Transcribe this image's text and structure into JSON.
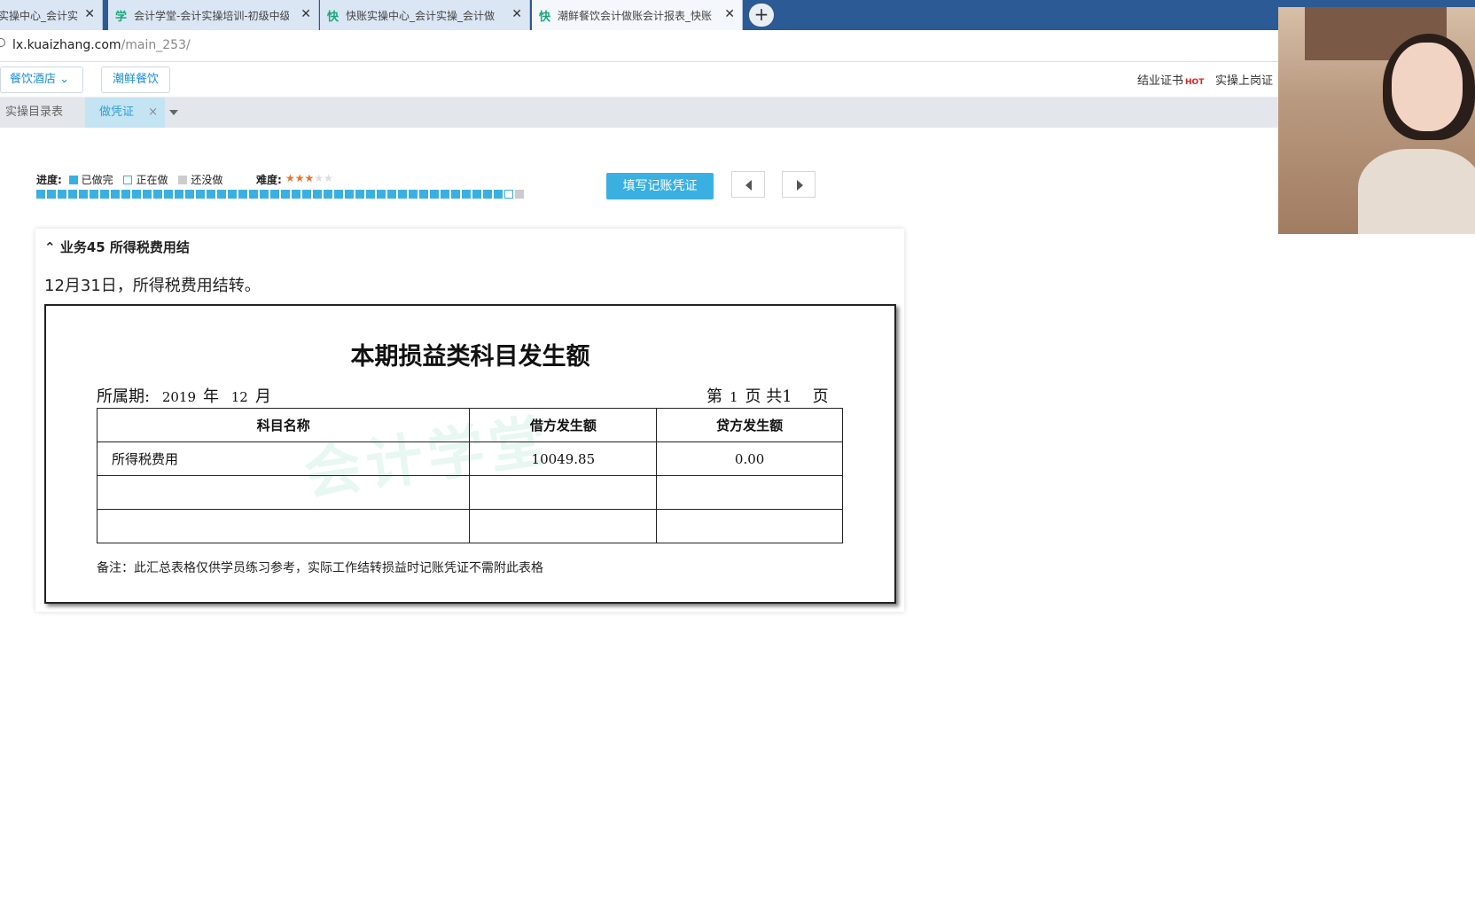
{
  "browser_tabs": [
    {
      "icon": "",
      "title": "实操中心_会计实",
      "active": false
    },
    {
      "icon": "学",
      "title": "会计学堂-会计实操培训-初级中级",
      "active": false
    },
    {
      "icon": "快",
      "title": "快账实操中心_会计实操_会计做",
      "active": false
    },
    {
      "icon": "快",
      "title": "潮鲜餐饮会计做账会计报表_快账",
      "active": true
    }
  ],
  "address": {
    "host": "lx.kuaizhang.com",
    "path": "/main_253/"
  },
  "nav": {
    "industry_label": "餐饮酒店",
    "company_label": "潮鲜餐饮",
    "cert_label": "结业证书",
    "hot_badge": "HOT",
    "job_cert_label": "实操上岗证"
  },
  "subtabs": {
    "catalog": "实操目录表",
    "voucher": "做凭证",
    "close": "×"
  },
  "progress": {
    "label": "进度:",
    "done_label": "已做完",
    "doing_label": "正在做",
    "todo_label": "还没做",
    "difficulty_label": "难度:",
    "difficulty_stars": 3,
    "difficulty_max": 5,
    "total": 45,
    "done": 44
  },
  "fill_button": "填写记账凭证",
  "task": {
    "title": "业务45 所得税费用结",
    "description": "12月31日，所得税费用结转。"
  },
  "doc": {
    "title": "本期损益类科目发生额",
    "period_prefix": "所属期:",
    "year": "2019",
    "year_unit": "年",
    "month": "12",
    "month_unit": "月",
    "page_prefix": "第",
    "page_num": "1",
    "page_mid": "页 共1",
    "page_suffix": "页",
    "watermark": "会计学堂",
    "headers": [
      "科目名称",
      "借方发生额",
      "贷方发生额"
    ],
    "rows": [
      [
        "所得税费用",
        "10049.85",
        "0.00"
      ],
      [
        "",
        "",
        ""
      ],
      [
        "",
        "",
        ""
      ]
    ],
    "note": "备注：此汇总表格仅供学员练习参考，实际工作结转损益时记账凭证不需附此表格"
  },
  "colors": {
    "accent": "#3ab0e2",
    "tab_bar": "#2c5a94"
  }
}
